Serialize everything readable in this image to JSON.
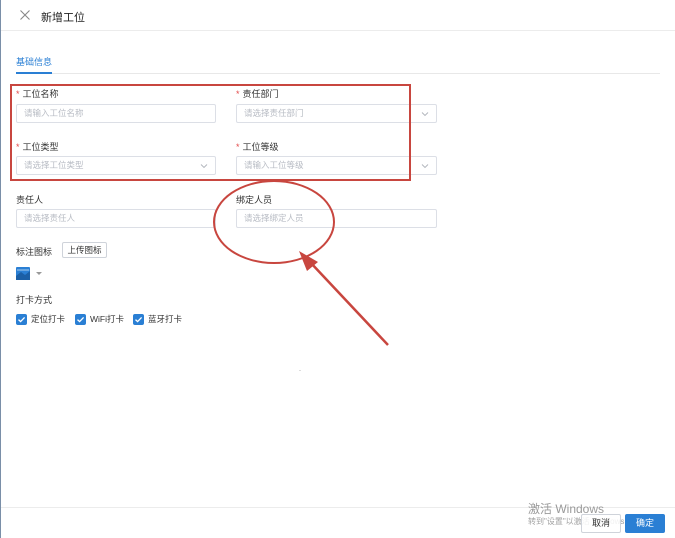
{
  "header": {
    "title": "新增工位",
    "close_icon": "close-icon"
  },
  "tabs": [
    {
      "label": "基础信息",
      "active": true
    }
  ],
  "form": {
    "workstation_name": {
      "label": "工位名称",
      "required": true,
      "placeholder": "请输入工位名称"
    },
    "department": {
      "label": "责任部门",
      "required": true,
      "placeholder": "请选择责任部门"
    },
    "workstation_type": {
      "label": "工位类型",
      "required": true,
      "placeholder": "请选择工位类型"
    },
    "workstation_level": {
      "label": "工位等级",
      "required": true,
      "placeholder": "请输入工位等级"
    },
    "responsible_person": {
      "label": "责任人",
      "placeholder": "请选择责任人"
    },
    "bound_staff": {
      "label": "绑定人员",
      "placeholder": "请选择绑定人员"
    },
    "marker_icon": {
      "label": "标注图标",
      "upload_label": "上传图标"
    },
    "checkin": {
      "label": "打卡方式",
      "options": [
        {
          "label": "定位打卡",
          "checked": true
        },
        {
          "label": "WiFi打卡",
          "checked": true
        },
        {
          "label": "蓝牙打卡",
          "checked": true
        }
      ]
    }
  },
  "footer": {
    "cancel_label": "取消",
    "ok_label": "确定"
  },
  "watermark": {
    "title": "激活 Windows",
    "subtitle": "转到\"设置\"以激活 Windows"
  },
  "colors": {
    "primary": "#2a7fd4",
    "required": "#e34a4a",
    "annotation": "#c8463f"
  }
}
